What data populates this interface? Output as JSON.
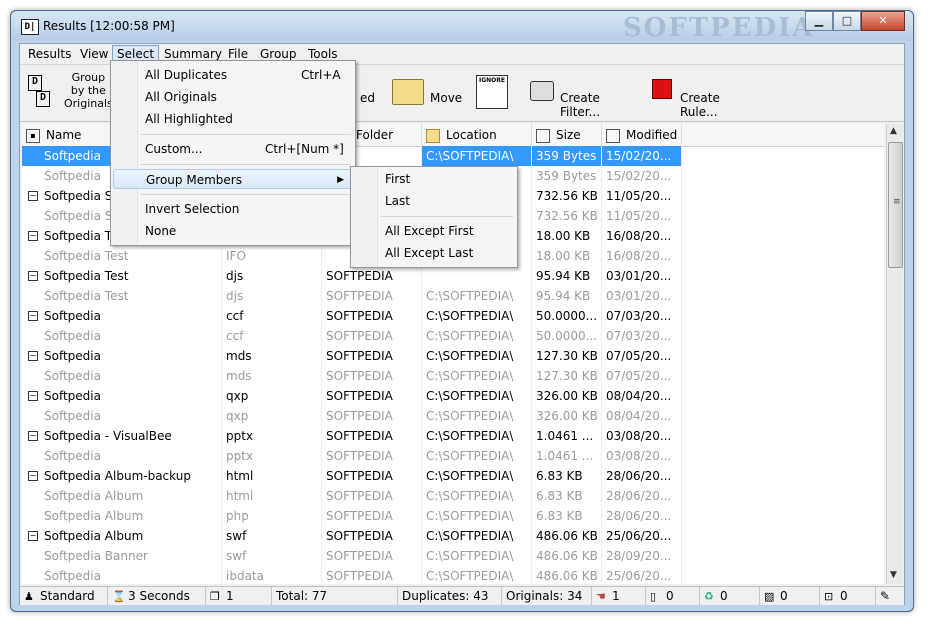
{
  "window": {
    "title": "Results [12:00:58 PM]",
    "icon_text": "D|",
    "watermark": "SOFTPEDIA",
    "minimize": "▁",
    "maximize": "□",
    "close": "✕"
  },
  "menu": [
    "Results",
    "View",
    "Select",
    "Summary",
    "File",
    "Group",
    "Tools"
  ],
  "toolbar": {
    "group_label_line1": "Group",
    "group_label_line2": "by the",
    "group_label_line3": "Originals",
    "partial_label": "ed",
    "move_label": "Move",
    "ignore_label": "IGNORE",
    "create_filter_label": "Create Filter...",
    "create_rule_label": "Create Rule..."
  },
  "columns": [
    "Name",
    "Folder",
    "Location",
    "Size",
    "Modified"
  ],
  "rows": [
    {
      "type": "group",
      "name": "Softpedia",
      "ext": "",
      "folder": "",
      "location": "C:\\SOFTPEDIA\\",
      "size": "359 Bytes",
      "modified": "15/02/20...",
      "selected": true
    },
    {
      "type": "sub",
      "name": "Softpedia",
      "ext": "",
      "folder": "",
      "location": "",
      "size": "359 Bytes",
      "modified": "15/02/20..."
    },
    {
      "type": "group",
      "name": "Softpedia S",
      "ext": "",
      "folder": "",
      "location": "",
      "size": "732.56 KB",
      "modified": "11/05/20..."
    },
    {
      "type": "sub",
      "name": "Softpedia S",
      "ext": "",
      "folder": "",
      "location": "",
      "size": "732.56 KB",
      "modified": "11/05/20..."
    },
    {
      "type": "group",
      "name": "Softpedia T",
      "ext": "",
      "folder": "",
      "location": "",
      "size": "18.00 KB",
      "modified": "16/08/20..."
    },
    {
      "type": "sub",
      "name": "Softpedia Test",
      "ext": "IFO",
      "folder": "",
      "location": "",
      "size": "18.00 KB",
      "modified": "16/08/20..."
    },
    {
      "type": "group",
      "name": "Softpedia Test",
      "ext": "djs",
      "folder": "SOFTPEDIA",
      "location": "",
      "size": "95.94 KB",
      "modified": "03/01/20..."
    },
    {
      "type": "sub",
      "name": "Softpedia Test",
      "ext": "djs",
      "folder": "SOFTPEDIA",
      "location": "C:\\SOFTPEDIA\\",
      "size": "95.94 KB",
      "modified": "03/01/20..."
    },
    {
      "type": "group",
      "name": "Softpedia",
      "ext": "ccf",
      "folder": "SOFTPEDIA",
      "location": "C:\\SOFTPEDIA\\",
      "size": "50.0000...",
      "modified": "07/03/20..."
    },
    {
      "type": "sub",
      "name": "Softpedia",
      "ext": "ccf",
      "folder": "SOFTPEDIA",
      "location": "C:\\SOFTPEDIA\\",
      "size": "50.0000...",
      "modified": "07/03/20..."
    },
    {
      "type": "group",
      "name": "Softpedia",
      "ext": "mds",
      "folder": "SOFTPEDIA",
      "location": "C:\\SOFTPEDIA\\",
      "size": "127.30 KB",
      "modified": "07/05/20..."
    },
    {
      "type": "sub",
      "name": "Softpedia",
      "ext": "mds",
      "folder": "SOFTPEDIA",
      "location": "C:\\SOFTPEDIA\\",
      "size": "127.30 KB",
      "modified": "07/05/20..."
    },
    {
      "type": "group",
      "name": "Softpedia",
      "ext": "qxp",
      "folder": "SOFTPEDIA",
      "location": "C:\\SOFTPEDIA\\",
      "size": "326.00 KB",
      "modified": "08/04/20..."
    },
    {
      "type": "sub",
      "name": "Softpedia",
      "ext": "qxp",
      "folder": "SOFTPEDIA",
      "location": "C:\\SOFTPEDIA\\",
      "size": "326.00 KB",
      "modified": "08/04/20..."
    },
    {
      "type": "group",
      "name": "Softpedia - VisualBee",
      "ext": "pptx",
      "folder": "SOFTPEDIA",
      "location": "C:\\SOFTPEDIA\\",
      "size": "1.0461 ...",
      "modified": "03/08/20..."
    },
    {
      "type": "sub",
      "name": "Softpedia",
      "ext": "pptx",
      "folder": "SOFTPEDIA",
      "location": "C:\\SOFTPEDIA\\",
      "size": "1.0461 ...",
      "modified": "03/08/20..."
    },
    {
      "type": "group",
      "name": "Softpedia Album-backup",
      "ext": "html",
      "folder": "SOFTPEDIA",
      "location": "C:\\SOFTPEDIA\\",
      "size": "6.83 KB",
      "modified": "28/06/20..."
    },
    {
      "type": "sub",
      "name": "Softpedia Album",
      "ext": "html",
      "folder": "SOFTPEDIA",
      "location": "C:\\SOFTPEDIA\\",
      "size": "6.83 KB",
      "modified": "28/06/20..."
    },
    {
      "type": "sub",
      "name": "Softpedia Album",
      "ext": "php",
      "folder": "SOFTPEDIA",
      "location": "C:\\SOFTPEDIA\\",
      "size": "6.83 KB",
      "modified": "28/06/20..."
    },
    {
      "type": "group",
      "name": "Softpedia Album",
      "ext": "swf",
      "folder": "SOFTPEDIA",
      "location": "C:\\SOFTPEDIA\\",
      "size": "486.06 KB",
      "modified": "25/06/20..."
    },
    {
      "type": "sub",
      "name": "Softpedia Banner",
      "ext": "swf",
      "folder": "SOFTPEDIA",
      "location": "C:\\SOFTPEDIA\\",
      "size": "486.06 KB",
      "modified": "28/09/20..."
    },
    {
      "type": "sub",
      "name": "Softpedia",
      "ext": "ibdata",
      "folder": "SOFTPEDIA",
      "location": "C:\\SOFTPEDIA\\",
      "size": "486.06 KB",
      "modified": "25/06/20..."
    }
  ],
  "select_menu": {
    "items": [
      {
        "label": "All Duplicates",
        "shortcut": "Ctrl+A"
      },
      {
        "label": "All Originals",
        "shortcut": ""
      },
      {
        "label": "All Highlighted",
        "shortcut": ""
      },
      {
        "label": "Custom...",
        "shortcut": "Ctrl+[Num *]"
      },
      {
        "label": "Group Members",
        "shortcut": ""
      },
      {
        "label": "Invert Selection",
        "shortcut": ""
      },
      {
        "label": "None",
        "shortcut": ""
      }
    ]
  },
  "group_members_menu": [
    "First",
    "Last",
    "All Except First",
    "All Except Last"
  ],
  "status": {
    "mode": "Standard",
    "time": "3 Seconds",
    "pages": "1",
    "total": "Total: 77",
    "duplicates": "Duplicates: 43",
    "originals": "Originals: 34",
    "c1": "1",
    "c2": "0",
    "c3": "0",
    "c4": "0",
    "c5": "0"
  },
  "colors": {
    "selection": "#3399ff",
    "dim_text": "#9b9b9b",
    "title_bg": "#bcd3ea"
  }
}
